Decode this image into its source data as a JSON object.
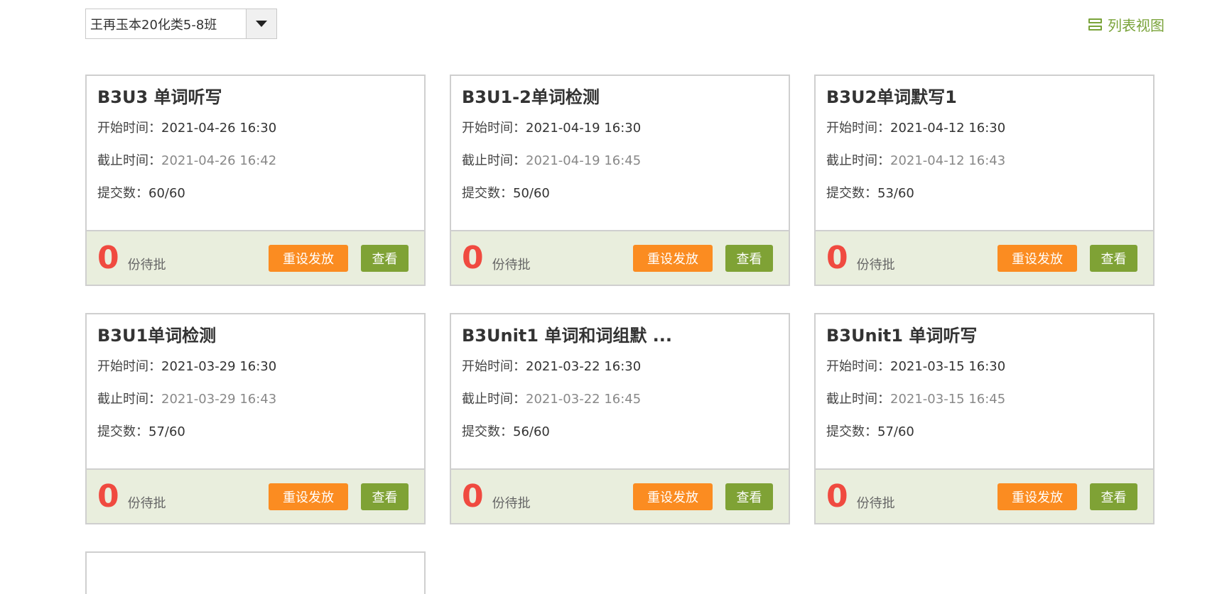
{
  "class_selector": {
    "value": "王再玉本20化类5-8班"
  },
  "view_toggle": {
    "label": "列表视图"
  },
  "labels": {
    "start": "开始时间：",
    "end": "截止时间：",
    "submitted": "提交数：",
    "pending": "份待批",
    "reset_button": "重设发放",
    "view_button": "查看"
  },
  "colors": {
    "accent_green": "#7aa33a",
    "view_button": "#7fa235",
    "reset_button": "#fb8c21",
    "count_red": "#f04a40",
    "footer_bg": "#e9eedd"
  },
  "cards": [
    {
      "title": "B3U3 单词听写",
      "start": "2021-04-26 16:30",
      "end": "2021-04-26 16:42",
      "submitted": "60/60",
      "pending_count": "0"
    },
    {
      "title": "B3U1-2单词检测",
      "start": "2021-04-19 16:30",
      "end": "2021-04-19 16:45",
      "submitted": "50/60",
      "pending_count": "0"
    },
    {
      "title": "B3U2单词默写1",
      "start": "2021-04-12 16:30",
      "end": "2021-04-12 16:43",
      "submitted": "53/60",
      "pending_count": "0"
    },
    {
      "title": "B3U1单词检测",
      "start": "2021-03-29 16:30",
      "end": "2021-03-29 16:43",
      "submitted": "57/60",
      "pending_count": "0"
    },
    {
      "title": "B3Unit1 单词和词组默 ...",
      "start": "2021-03-22 16:30",
      "end": "2021-03-22 16:45",
      "submitted": "56/60",
      "pending_count": "0"
    },
    {
      "title": "B3Unit1 单词听写",
      "start": "2021-03-15 16:30",
      "end": "2021-03-15 16:45",
      "submitted": "57/60",
      "pending_count": "0"
    }
  ]
}
